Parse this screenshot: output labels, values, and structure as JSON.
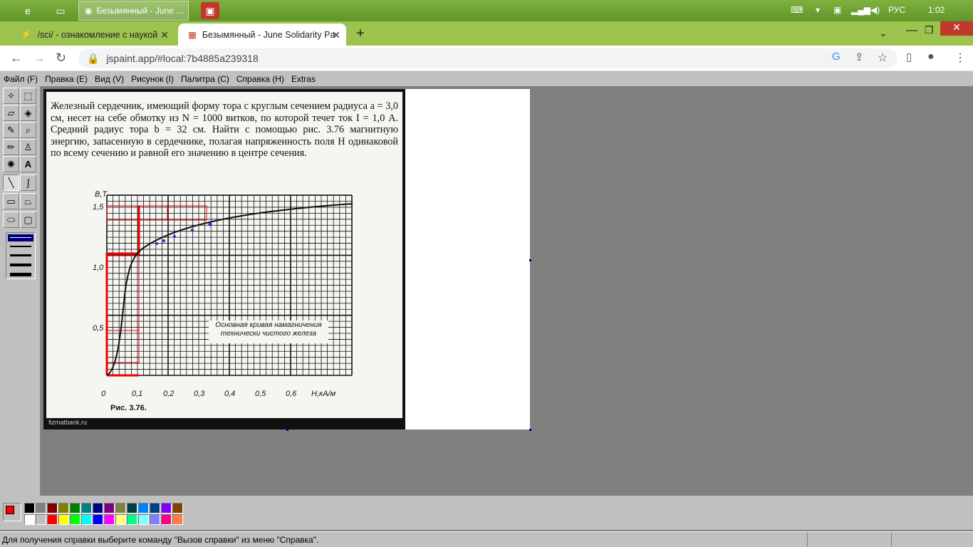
{
  "taskbar": {
    "window_button_label": "Безымянный - June ...",
    "language": "РУС",
    "time": "1:02"
  },
  "browser": {
    "tabs": [
      {
        "label": "/sci/ - ознакомление с наукой"
      },
      {
        "label": "Безымянный - June Solidarity Pa"
      }
    ],
    "url": "jspaint.app/#local:7b4885a239318"
  },
  "app": {
    "menu": [
      "Файл (F)",
      "Правка (E)",
      "Вид (V)",
      "Рисунок (I)",
      "Палитра (C)",
      "Справка (H)",
      "Extras"
    ],
    "status": "Для получения справки выберите команду \"Вызов справки\" из меню \"Справка\"."
  },
  "image": {
    "paragraph": "Железный сердечник, имеющий форму тора с круглым сечением радиуса a = 3,0 см, несет на себе обмотку из N = 1000 витков, по которой течет ток I = 1,0 А. Средний радиус тора b = 32 см. Найти с помощью рис. 3.76 магнитную энергию, запасенную в сердечнике, полагая напряженность поля H одинаковой по всему сечению и равной его значению в центре сечения.",
    "watermark": "fizmatbank.ru",
    "figure_caption": "Рис. 3.76.",
    "legend_label": "Основная кривая намагничения технически чистого железа",
    "y_axis_label": "B,T",
    "x_axis_label": "H,кА/м",
    "y_ticks": [
      "1,5",
      "1,0",
      "0,5"
    ],
    "x_ticks": [
      "0",
      "0,1",
      "0,2",
      "0,3",
      "0,4",
      "0,5",
      "0,6"
    ]
  },
  "palette": {
    "primary": "#ff0000",
    "secondary": "#ffffff",
    "colors_top": [
      "#000000",
      "#808080",
      "#800000",
      "#808000",
      "#008000",
      "#008080",
      "#000080",
      "#800080",
      "#808040",
      "#004040",
      "#0080ff",
      "#004080",
      "#8000ff",
      "#804000"
    ],
    "colors_bottom": [
      "#ffffff",
      "#c0c0c0",
      "#ff0000",
      "#ffff00",
      "#00ff00",
      "#00ffff",
      "#0000ff",
      "#ff00ff",
      "#ffff80",
      "#00ff80",
      "#80ffff",
      "#8080ff",
      "#ff0080",
      "#ff8040"
    ]
  }
}
